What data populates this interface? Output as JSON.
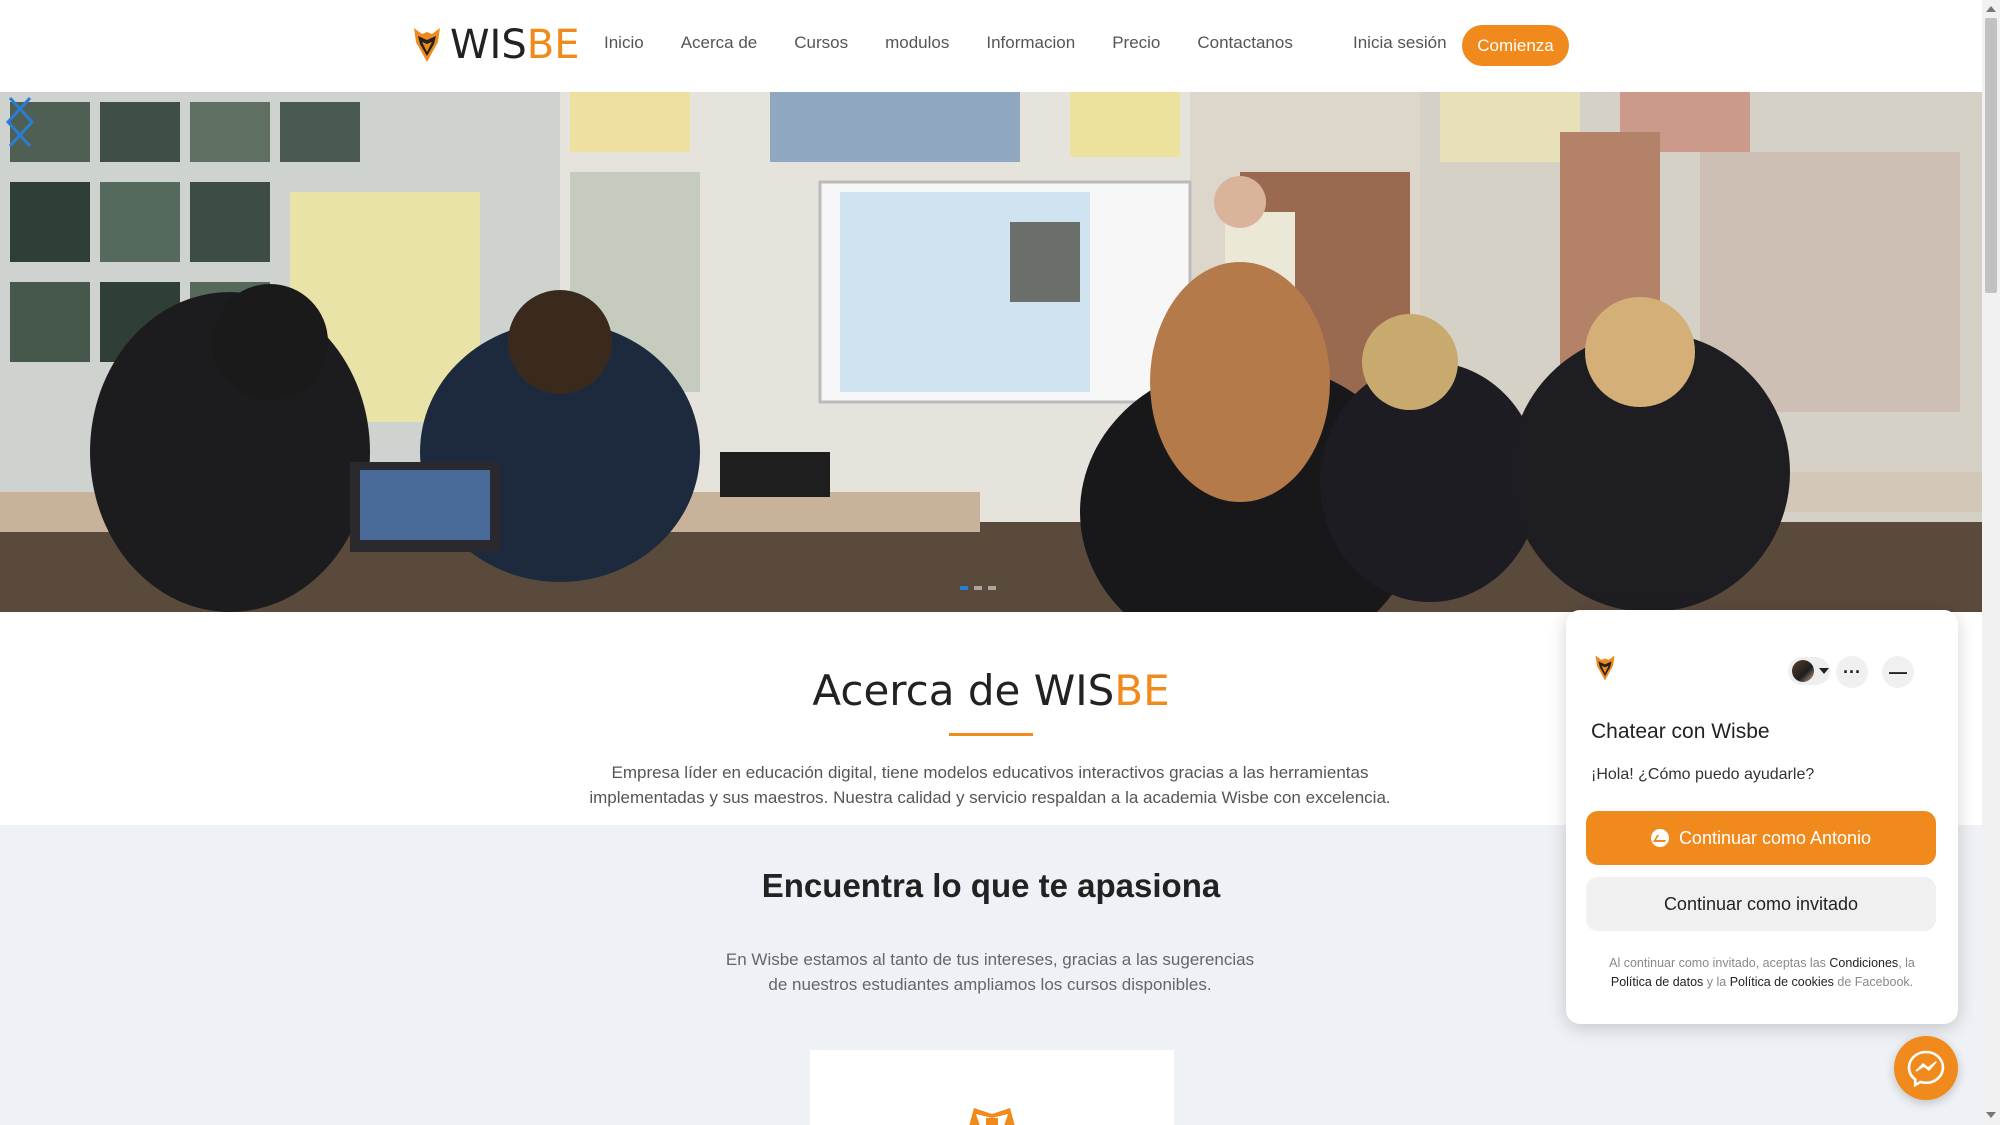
{
  "brand": {
    "name_dark": "WIS",
    "name_orange": "BE",
    "accent_color": "#f18a1c",
    "logo_icon": "shield-fox-icon"
  },
  "nav": {
    "items": [
      "Inicio",
      "Acerca de",
      "Cursos",
      "modulos",
      "Informacion",
      "Precio",
      "Contactanos"
    ],
    "login_label": "Inicia sesión",
    "cta_label": "Comienza"
  },
  "hero": {
    "image": "classroom-photo",
    "prev_icon": "chevron-left-icon",
    "next_icon": "chevron-right-icon",
    "slide_count": 3,
    "active_slide": 1
  },
  "about": {
    "title_prefix": "Acerca de ",
    "title_dark": "WIS",
    "title_orange": "BE",
    "text_line1": "Empresa líder en educación digital, tiene modelos educativos interactivos gracias a las herramientas",
    "text_line2": "implementadas y sus maestros. Nuestra calidad y servicio respaldan a la academia Wisbe con excelencia."
  },
  "passion": {
    "title": "Encuentra lo que te apasiona",
    "text_line1": "En Wisbe estamos al tanto de tus intereses, gracias a las sugerencias",
    "text_line2": "de nuestros estudiantes ampliamos los cursos disponibles."
  },
  "chat": {
    "title": "Chatear con Wisbe",
    "greeting": "¡Hola! ¿Cómo puedo ayudarle?",
    "continue_as_user": "Continuar como Antonio",
    "continue_as_guest": "Continuar como invitado",
    "more_label": "···",
    "min_label": "—",
    "legal_1": "Al continuar como invitado, aceptas las ",
    "legal_terms": "Condiciones",
    "legal_2": ", la",
    "legal_data": "Política de datos",
    "legal_3": " y la ",
    "legal_cookies": "Política de cookies",
    "legal_4": " de Facebook."
  }
}
